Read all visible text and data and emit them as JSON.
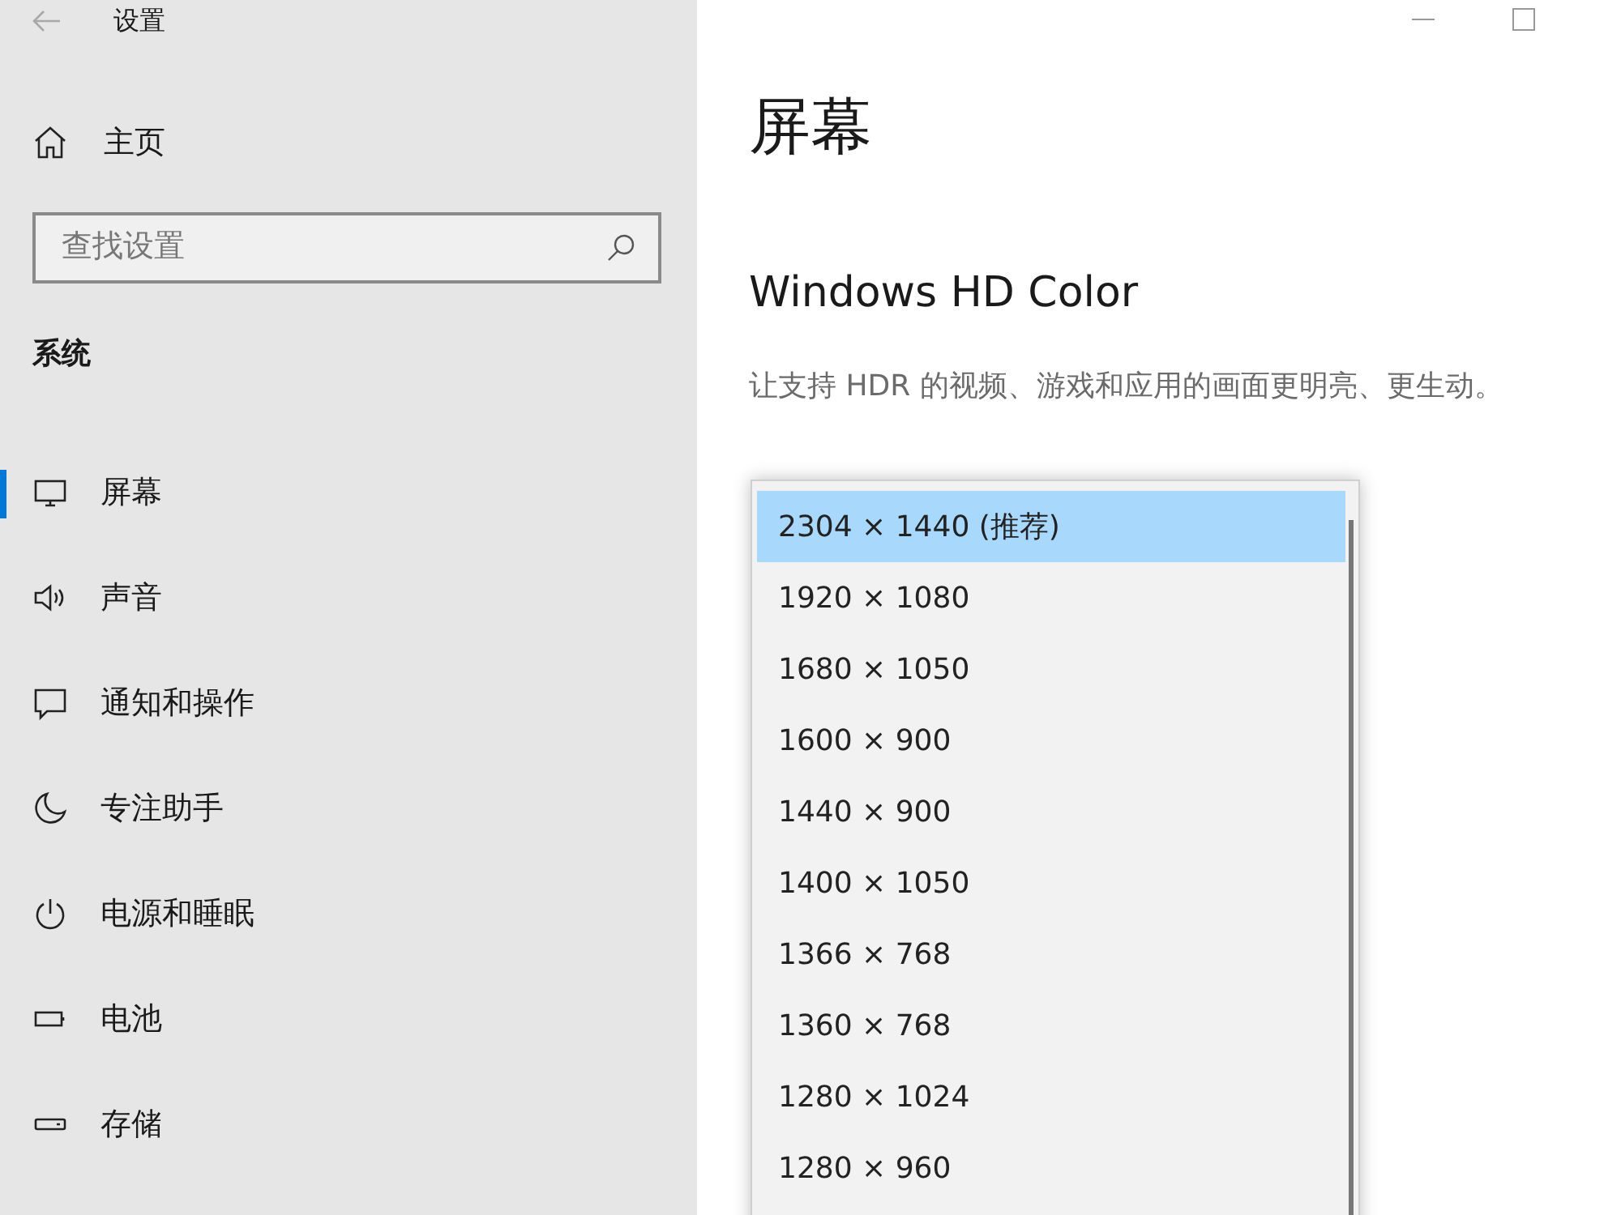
{
  "window": {
    "title": "设置"
  },
  "sidebar": {
    "home": "主页",
    "search": {
      "placeholder": "查找设置"
    },
    "section": "系统",
    "items": [
      {
        "label": "屏幕",
        "selected": true
      },
      {
        "label": "声音",
        "selected": false
      },
      {
        "label": "通知和操作",
        "selected": false
      },
      {
        "label": "专注助手",
        "selected": false
      },
      {
        "label": "电源和睡眠",
        "selected": false
      },
      {
        "label": "电池",
        "selected": false
      },
      {
        "label": "存储",
        "selected": false
      }
    ]
  },
  "page": {
    "title": "屏幕",
    "section_title": "Windows HD Color",
    "description": "让支持 HDR 的视频、游戏和应用的画面更明亮、更生动。"
  },
  "resolution_dropdown": {
    "options": [
      {
        "label": "2304 × 1440 (推荐)",
        "selected": true
      },
      {
        "label": "1920 × 1080",
        "selected": false
      },
      {
        "label": "1680 × 1050",
        "selected": false
      },
      {
        "label": "1600 × 900",
        "selected": false
      },
      {
        "label": "1440 × 900",
        "selected": false
      },
      {
        "label": "1400 × 1050",
        "selected": false
      },
      {
        "label": "1366 × 768",
        "selected": false
      },
      {
        "label": "1360 × 768",
        "selected": false
      },
      {
        "label": "1280 × 1024",
        "selected": false
      },
      {
        "label": "1280 × 960",
        "selected": false
      }
    ]
  }
}
